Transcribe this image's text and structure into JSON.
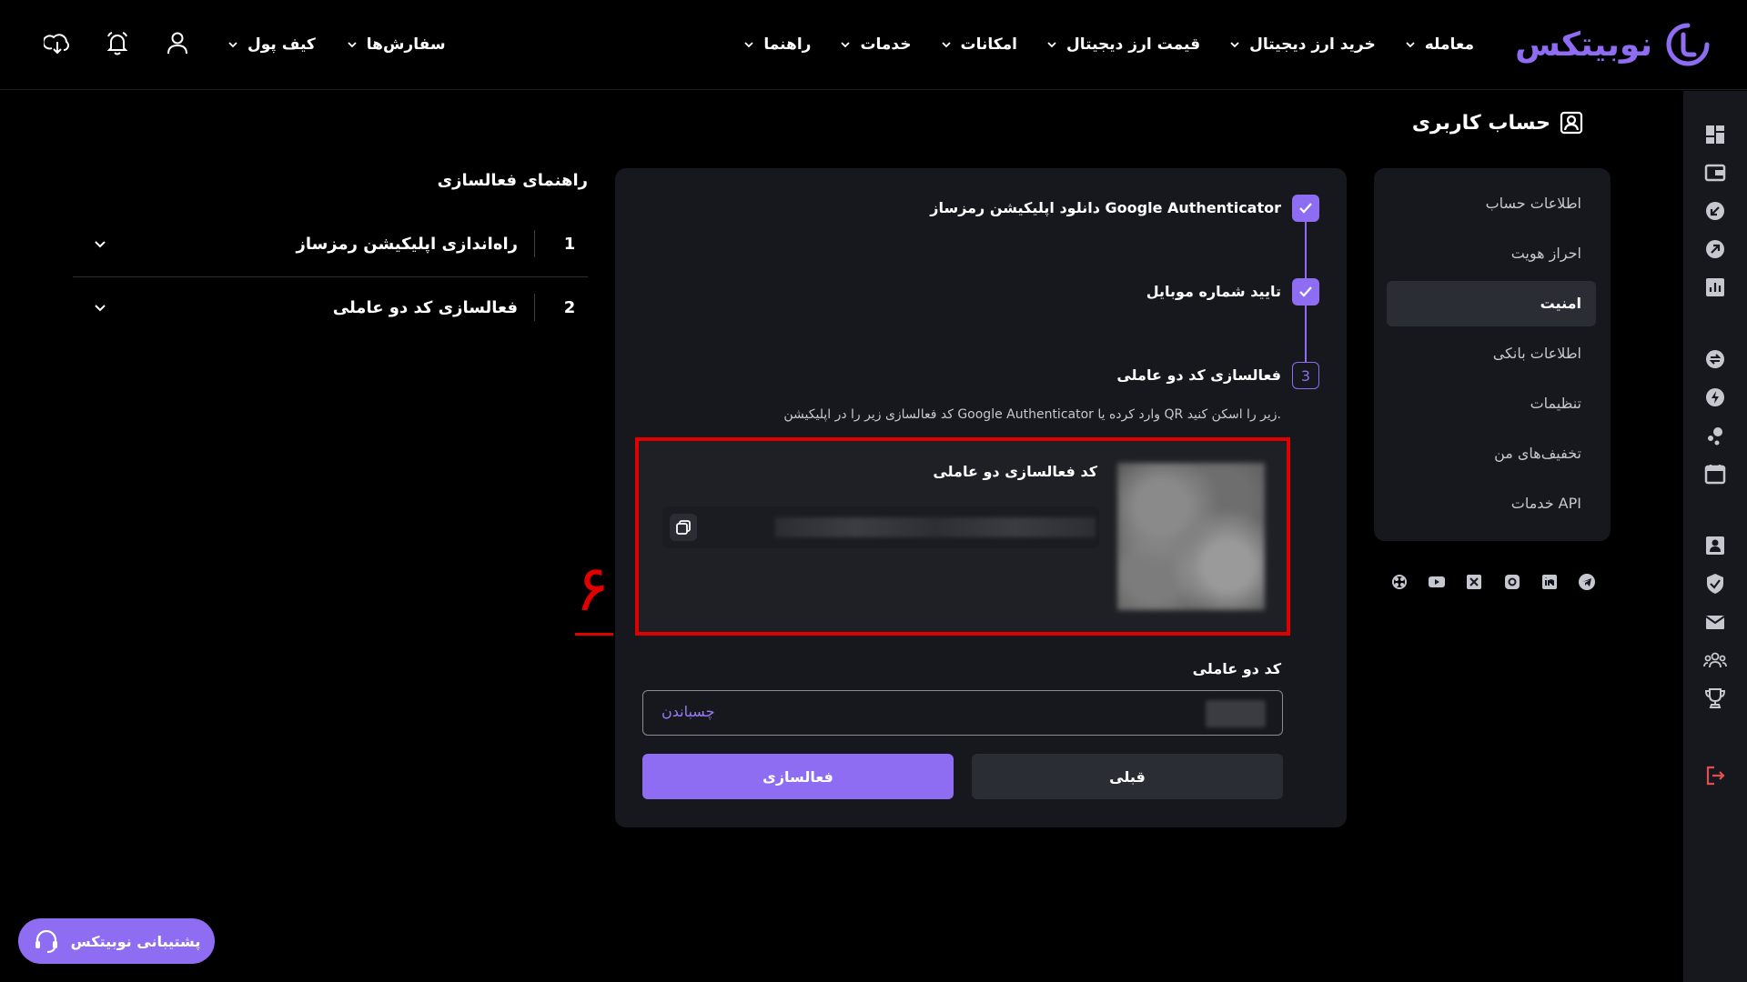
{
  "brand": {
    "name": "نوبیتکس",
    "accent": "#8f6df2"
  },
  "nav": {
    "main": [
      "معامله",
      "خرید ارز دیجیتال",
      "قیمت ارز دیجیتال",
      "امکانات",
      "خدمات",
      "راهنما"
    ],
    "orders": "سفارش‌ها",
    "wallet": "کیف پول"
  },
  "top_icons": [
    "user-icon",
    "bell-icon",
    "download-app-icon"
  ],
  "rail_icons": [
    "dashboard-icon",
    "wallet-icon",
    "deposit-icon",
    "withdraw-icon",
    "chart-icon",
    "exchange-icon",
    "bolt-icon",
    "staking-icon",
    "calendar-icon",
    "profile-icon",
    "shield-icon",
    "mail-icon",
    "referral-icon",
    "trophy-icon",
    "logout-icon"
  ],
  "page": {
    "title": "حساب کاربری"
  },
  "account_menu": {
    "items": [
      "اطلاعات حساب",
      "احراز هویت",
      "امنیت",
      "اطلاعات بانکی",
      "تنظیمات",
      "تخفیف‌های من",
      "خدمات API"
    ],
    "active": "امنیت"
  },
  "socials": [
    "telegram-icon",
    "linkedin-icon",
    "instagram-icon",
    "x-icon",
    "youtube-icon",
    "aparat-icon"
  ],
  "steps": {
    "step1": "دانلود اپلیکیشن رمزساز Google Authenticator",
    "step2": "تایید شماره موبایل",
    "step3_num": "3",
    "step3": "فعالسازی کد دو عاملی",
    "description": "کد فعالسازی زیر را در اپلیکیشن Google Authenticator وارد کرده یا QR زیر را اسکن کنید."
  },
  "activation": {
    "title": "کد فعالسازی دو عاملی"
  },
  "tfa": {
    "label": "کد دو عاملی",
    "paste": "چسباندن",
    "value": ""
  },
  "buttons": {
    "activate": "فعالسازی",
    "previous": "قبلی"
  },
  "annotation": "۶",
  "guide": {
    "title": "راهنمای فعالسازی",
    "items": [
      {
        "num": "1",
        "text": "راه‌اندازی اپلیکیشن رمزساز"
      },
      {
        "num": "2",
        "text": "فعالسازی کد دو عاملی"
      }
    ]
  },
  "support": {
    "label": "پشتیبانی نوبیتکس"
  }
}
